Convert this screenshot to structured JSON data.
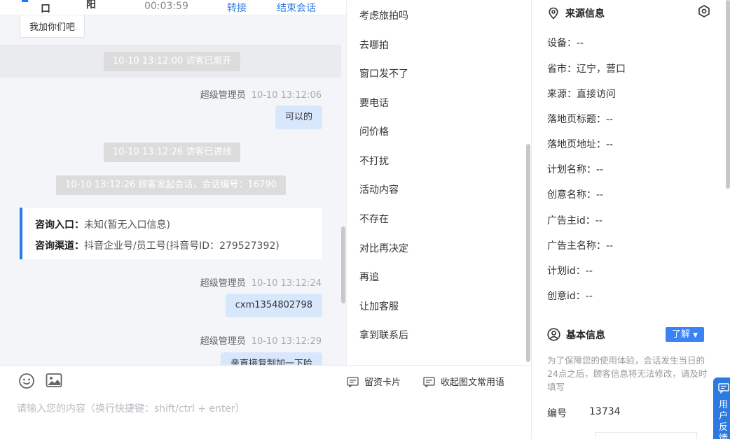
{
  "header": {
    "name_part1": "口",
    "name_part2": "阳",
    "timer": "00:03:59",
    "transfer_label": "转接",
    "end_session_label": "结束会话"
  },
  "messages": {
    "visitor_bubble": "我加你们吧",
    "sys_left": "10-10 13:12:00 访客已离开",
    "agent1_sender": "超级管理员",
    "agent1_time": "10-10 13:12:06",
    "agent1_text": "可以的",
    "sys_entered": "10-10 13:12:26 访客已进线",
    "sys_session": "10-10 13:12:26 顾客发起会话，会话编号：16790",
    "info_entry_label": "咨询入口：",
    "info_entry_value": "未知(暂无入口信息)",
    "info_channel_label": "咨询渠道：",
    "info_channel_value": "抖音企业号/员工号(抖音号ID：279527392)",
    "agent2_sender": "超级管理员",
    "agent2_time": "10-10 13:12:24",
    "agent2_text": "cxm1354802798",
    "agent3_sender": "超级管理员",
    "agent3_time": "10-10 13:12:29",
    "agent3_text": "亲直接复制加一下哈"
  },
  "input": {
    "placeholder": "请输入您的内容（换行快捷键：shift/ctrl + enter）",
    "card_label": "留资卡片",
    "collapse_label": "收起图文常用语"
  },
  "phrases": [
    "考虑旅拍吗",
    "去哪拍",
    "窗口发不了",
    "要电话",
    "问价格",
    "不打扰",
    "活动内容",
    "不存在",
    "对比再决定",
    "再追",
    "让加客服",
    "拿到联系后"
  ],
  "source_info": {
    "title": "来源信息",
    "device": "设备：--",
    "city": "省市：辽宁，营口",
    "source": "来源：直接访问",
    "landing_title": "落地页标题：--",
    "landing_url": "落地页地址：--",
    "plan_name": "计划名称：--",
    "creative_name": "创意名称：--",
    "advertiser_id": "广告主id：--",
    "advertiser_name": "广告主名称：--",
    "plan_id": "计划id：--",
    "creative_id": "创意id：--"
  },
  "basic_info": {
    "title": "基本信息",
    "learn_label": "了解",
    "notice": "为了保障您的使用体验，会话发生当日的24点之后，顾客信息将无法修改，请及时填写",
    "id_label": "编号",
    "id_value": "13734"
  },
  "feedback": {
    "label": "用户反馈"
  },
  "colors": {
    "accent": "#2a7ae2",
    "bubble": "#d9e7fd",
    "system_pill": "#dcdcdc"
  },
  "icons": [
    "emoji-icon",
    "image-icon",
    "card-icon",
    "phrase-icon",
    "location-pin-icon",
    "settings-icon",
    "user-icon",
    "feedback-icon"
  ]
}
